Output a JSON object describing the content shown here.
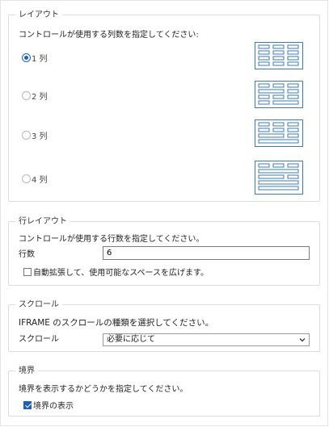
{
  "layout": {
    "legend": "レイアウト",
    "description": "コントロールが使用する列数を指定してください:",
    "options": [
      {
        "label": "1 列",
        "checked": true
      },
      {
        "label": "2 列",
        "checked": false
      },
      {
        "label": "3 列",
        "checked": false
      },
      {
        "label": "4 列",
        "checked": false
      }
    ]
  },
  "row_layout": {
    "legend": "行レイアウト",
    "description": "コントロールが使用する行数を指定してください。",
    "rows_label": "行数",
    "rows_value": "6",
    "auto_expand_label": "自動拡張して、使用可能なスペースを広げます。",
    "auto_expand_checked": false
  },
  "scroll": {
    "legend": "スクロール",
    "description": "IFRAME のスクロールの種類を選択してください。",
    "scroll_label": "スクロール",
    "scroll_value": "必要に応じて"
  },
  "border": {
    "legend": "境界",
    "description": "境界を表示するかどうかを指定してください。",
    "show_border_label": "境界の表示",
    "show_border_checked": true
  },
  "colors": {
    "accent": "#1a5fd0",
    "icon_stroke": "#3a78c2",
    "group_border": "#dcdcdc"
  }
}
